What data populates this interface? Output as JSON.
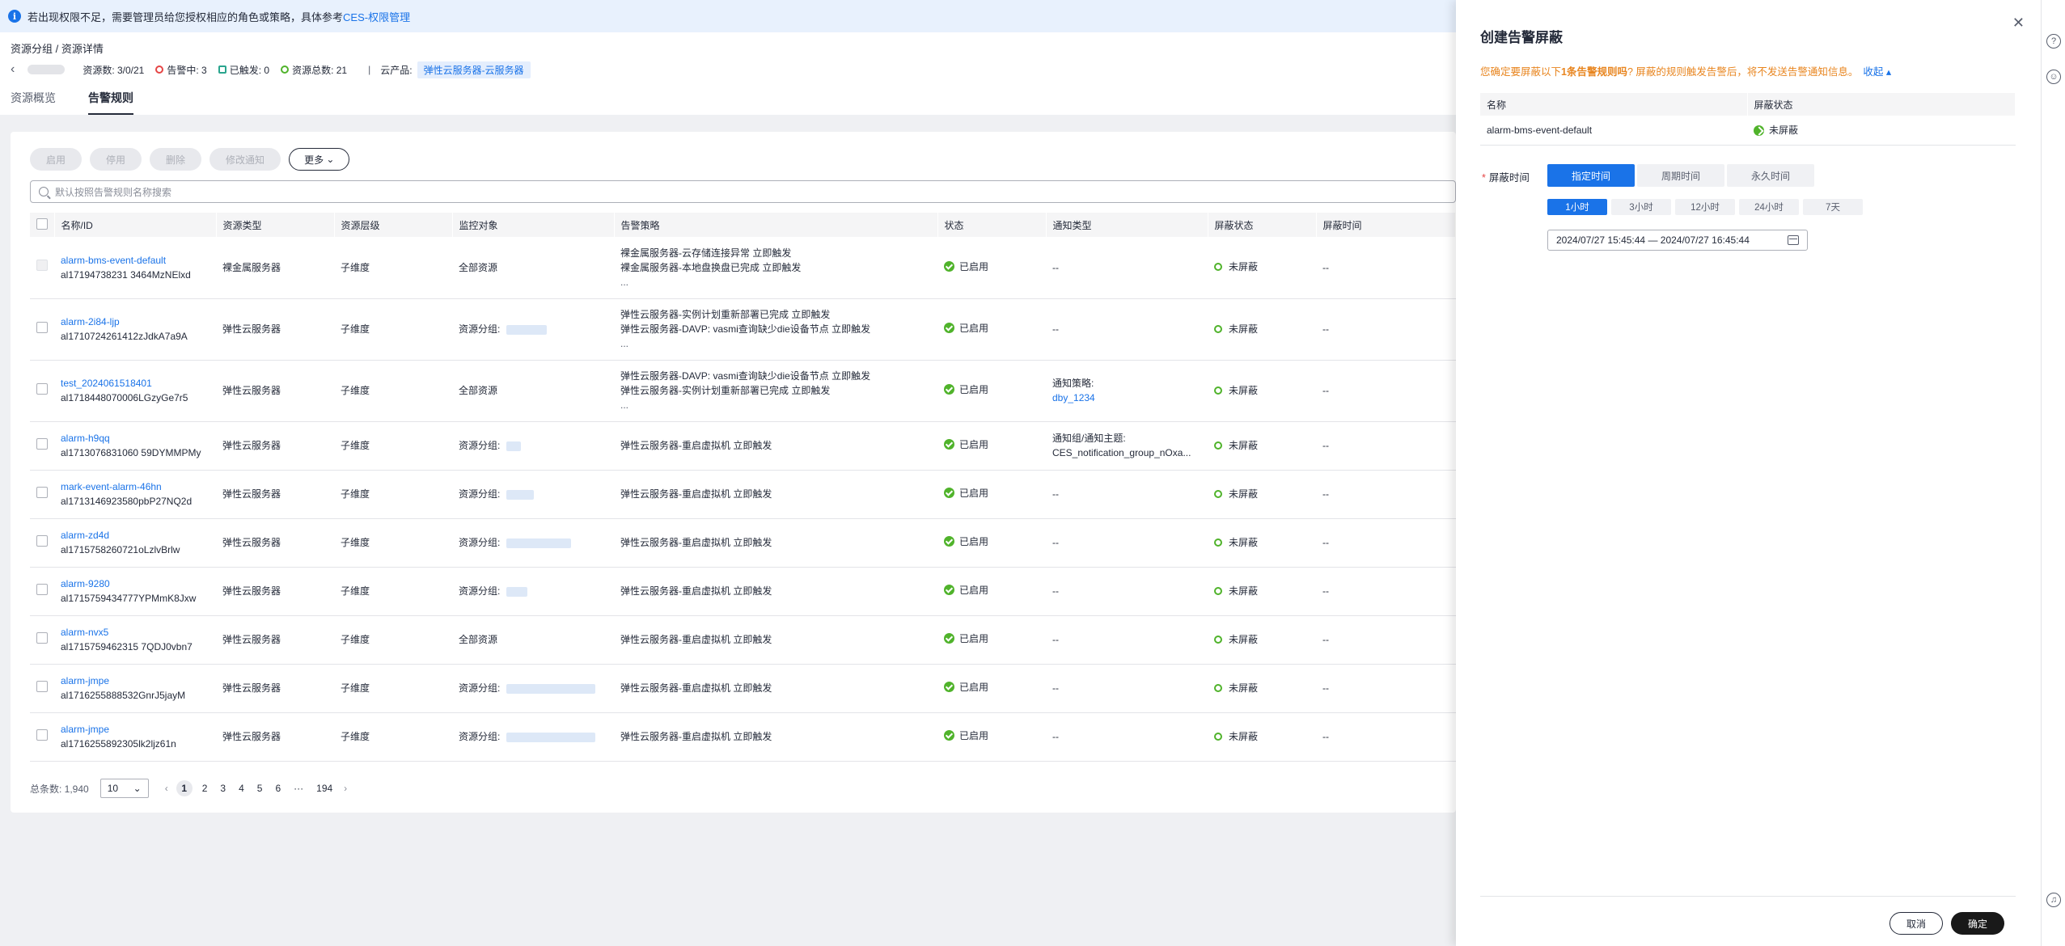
{
  "notice": {
    "text": "若出现权限不足，需要管理员给您授权相应的角色或策略，具体参考",
    "link": "CES-权限管理"
  },
  "breadcrumb": "资源分组 / 资源详情",
  "resource_bar": {
    "resource_count": "资源数:  3/0/21",
    "alarming": "告警中:  3",
    "triggered": "已触发:  0",
    "total": "资源总数:  21",
    "product_label": "云产品:",
    "product_tag": "弹性云服务器-云服务器"
  },
  "tabs": [
    {
      "label": "资源概览",
      "active": false
    },
    {
      "label": "告警规则",
      "active": true
    }
  ],
  "toolbar": {
    "enable": "启用",
    "disable": "停用",
    "delete": "删除",
    "modify_notify": "修改通知",
    "more": "更多"
  },
  "search": {
    "placeholder": "默认按照告警规则名称搜索"
  },
  "table": {
    "headers": [
      "名称/ID",
      "资源类型",
      "资源层级",
      "监控对象",
      "告警策略",
      "状态",
      "通知类型",
      "屏蔽状态",
      "屏蔽时间"
    ],
    "rows": [
      {
        "name": "alarm-bms-event-default",
        "id": "al17194738231 3464MzNElxd",
        "type": "裸金属服务器",
        "level": "子维度",
        "object": "全部资源",
        "policy": [
          "裸金属服务器-云存储连接异常 立即触发",
          "裸金属服务器-本地盘换盘已完成 立即触发",
          "..."
        ],
        "status": "已启用",
        "notify": "--",
        "mask": "未屏蔽",
        "mask_time": "--"
      },
      {
        "name": "alarm-2i84-ljp",
        "id": "al1710724261412zJdkA7a9A",
        "type": "弹性云服务器",
        "level": "子维度",
        "object": "资源分组: ",
        "policy": [
          "弹性云服务器-实例计划重新部署已完成 立即触发",
          "弹性云服务器-DAVP: vasmi查询缺少die设备节点 立即触发",
          "..."
        ],
        "status": "已启用",
        "notify": "--",
        "mask": "未屏蔽",
        "mask_time": "--"
      },
      {
        "name": "test_2024061518401",
        "id": "al1718448070006LGzyGe7r5",
        "type": "弹性云服务器",
        "level": "子维度",
        "object": "全部资源",
        "policy": [
          "弹性云服务器-DAVP: vasmi查询缺少die设备节点 立即触发",
          "弹性云服务器-实例计划重新部署已完成 立即触发",
          "..."
        ],
        "status": "已启用",
        "notify": "通知策略:",
        "notify_link": "dby_1234",
        "mask": "未屏蔽",
        "mask_time": "--"
      },
      {
        "name": "alarm-h9qq",
        "id": "al1713076831060 59DYMMPMy",
        "type": "弹性云服务器",
        "level": "子维度",
        "object": "资源分组: ",
        "policy": [
          "弹性云服务器-重启虚拟机 立即触发"
        ],
        "status": "已启用",
        "notify": "通知组/通知主题:",
        "notify_sub": "CES_notification_group_nOxa...",
        "mask": "未屏蔽",
        "mask_time": "--"
      },
      {
        "name": "mark-event-alarm-46hn",
        "id": "al1713146923580pbP27NQ2d",
        "type": "弹性云服务器",
        "level": "子维度",
        "object": "资源分组: ",
        "policy": [
          "弹性云服务器-重启虚拟机 立即触发"
        ],
        "status": "已启用",
        "notify": "--",
        "mask": "未屏蔽",
        "mask_time": "--"
      },
      {
        "name": "alarm-zd4d",
        "id": "al1715758260721oLzlvBrlw",
        "type": "弹性云服务器",
        "level": "子维度",
        "object": "资源分组: ",
        "policy": [
          "弹性云服务器-重启虚拟机 立即触发"
        ],
        "status": "已启用",
        "notify": "--",
        "mask": "未屏蔽",
        "mask_time": "--"
      },
      {
        "name": "alarm-9280",
        "id": "al1715759434777YPMmK8Jxw",
        "type": "弹性云服务器",
        "level": "子维度",
        "object": "资源分组: ",
        "policy": [
          "弹性云服务器-重启虚拟机 立即触发"
        ],
        "status": "已启用",
        "notify": "--",
        "mask": "未屏蔽",
        "mask_time": "--"
      },
      {
        "name": "alarm-nvx5",
        "id": "al1715759462315 7QDJ0vbn7",
        "type": "弹性云服务器",
        "level": "子维度",
        "object": "全部资源",
        "policy": [
          "弹性云服务器-重启虚拟机 立即触发"
        ],
        "status": "已启用",
        "notify": "--",
        "mask": "未屏蔽",
        "mask_time": "--"
      },
      {
        "name": "alarm-jmpe",
        "id": "al1716255888532GnrJ5jayM",
        "type": "弹性云服务器",
        "level": "子维度",
        "object": "资源分组: ",
        "policy": [
          "弹性云服务器-重启虚拟机 立即触发"
        ],
        "status": "已启用",
        "notify": "--",
        "mask": "未屏蔽",
        "mask_time": "--"
      },
      {
        "name": "alarm-jmpe",
        "id": "al1716255892305lk2ljz61n",
        "type": "弹性云服务器",
        "level": "子维度",
        "object": "资源分组: ",
        "policy": [
          "弹性云服务器-重启虚拟机 立即触发"
        ],
        "status": "已启用",
        "notify": "--",
        "mask": "未屏蔽",
        "mask_time": "--"
      }
    ]
  },
  "pager": {
    "total": "总条数: 1,940",
    "page_size": "10",
    "pages": [
      "1",
      "2",
      "3",
      "4",
      "5",
      "6",
      "···",
      "194"
    ]
  },
  "drawer": {
    "title": "创建告警屏蔽",
    "warning_prefix": "您确定要屏蔽以下",
    "warning_bold": "1条告警规则吗",
    "warning_suffix": "? 屏蔽的规则触发告警后，将不发送告警通知信息。",
    "collapse": "收起",
    "table_headers": [
      "名称",
      "屏蔽状态"
    ],
    "table_row": {
      "name": "alarm-bms-event-default",
      "status": "未屏蔽"
    },
    "mask_time_label": "屏蔽时间",
    "mode_options": [
      {
        "label": "指定时间",
        "active": true
      },
      {
        "label": "周期时间",
        "active": false
      },
      {
        "label": "永久时间",
        "active": false
      }
    ],
    "duration_options": [
      {
        "label": "1小时",
        "active": true
      },
      {
        "label": "3小时",
        "active": false
      },
      {
        "label": "12小时",
        "active": false
      },
      {
        "label": "24小时",
        "active": false
      },
      {
        "label": "7天",
        "active": false
      }
    ],
    "date_range": "2024/07/27 15:45:44 — 2024/07/27 16:45:44",
    "cancel": "取消",
    "ok": "确定"
  }
}
